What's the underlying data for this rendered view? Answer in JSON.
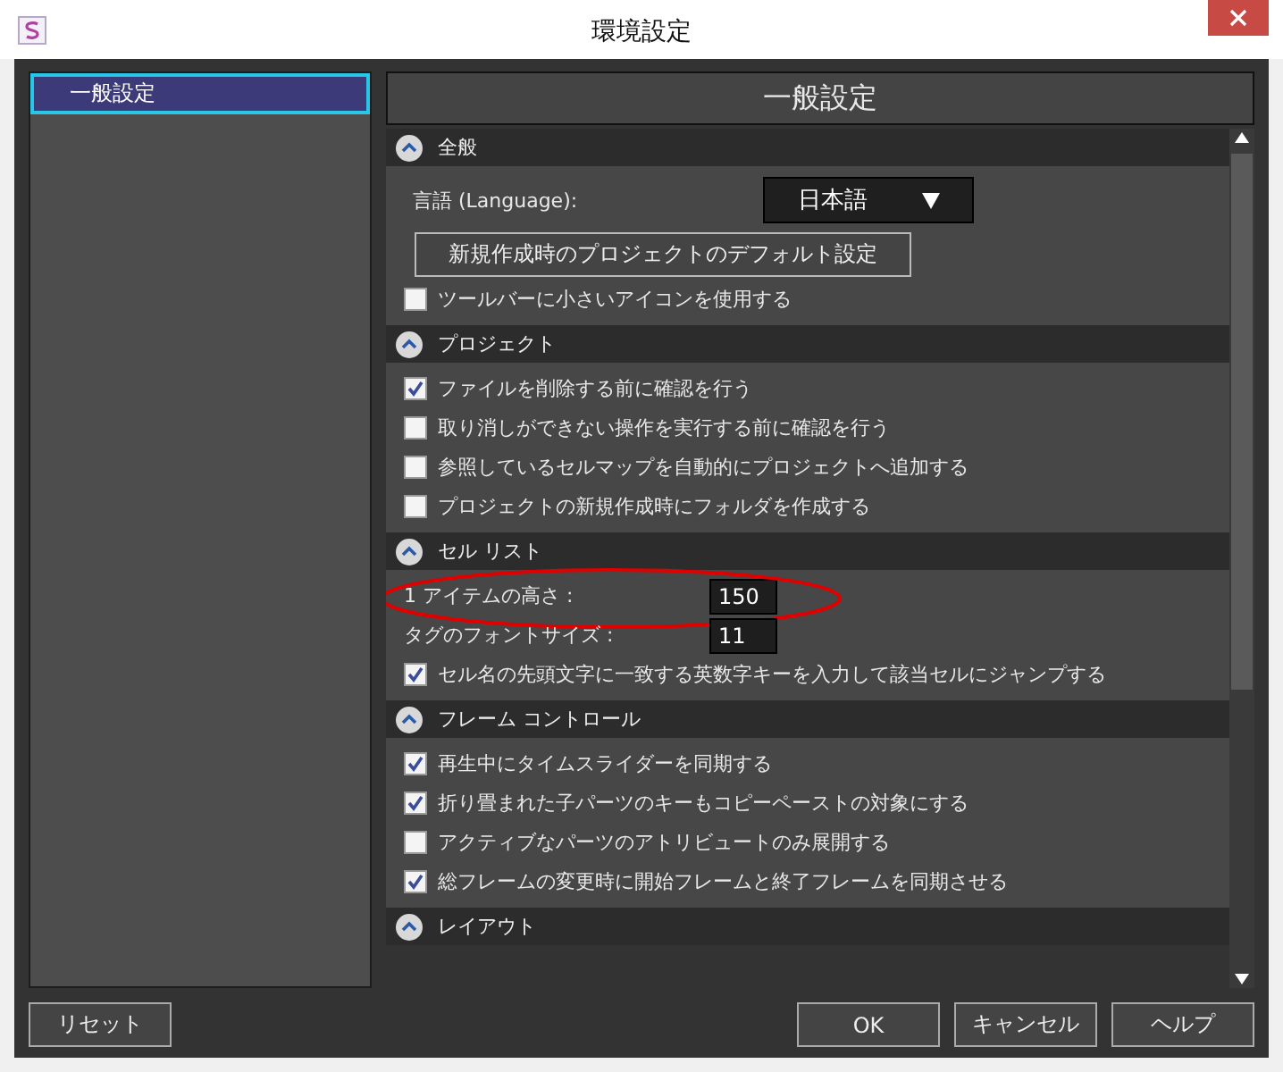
{
  "window": {
    "title": "環境設定"
  },
  "sidebar": {
    "items": [
      {
        "label": "一般設定",
        "selected": true
      }
    ]
  },
  "panel": {
    "title": "一般設定"
  },
  "sections": [
    {
      "title": "全般",
      "expanded": true,
      "items": [
        {
          "kind": "select",
          "label": "言語 (Language):",
          "value": "日本語"
        },
        {
          "kind": "button",
          "label": "新規作成時のプロジェクトのデフォルト設定"
        },
        {
          "kind": "checkbox",
          "label": "ツールバーに小さいアイコンを使用する",
          "checked": false
        }
      ]
    },
    {
      "title": "プロジェクト",
      "expanded": true,
      "items": [
        {
          "kind": "checkbox",
          "label": "ファイルを削除する前に確認を行う",
          "checked": true
        },
        {
          "kind": "checkbox",
          "label": "取り消しができない操作を実行する前に確認を行う",
          "checked": false
        },
        {
          "kind": "checkbox",
          "label": "参照しているセルマップを自動的にプロジェクトへ追加する",
          "checked": false
        },
        {
          "kind": "checkbox",
          "label": "プロジェクトの新規作成時にフォルダを作成する",
          "checked": false
        }
      ]
    },
    {
      "title": "セル リスト",
      "expanded": true,
      "items": [
        {
          "kind": "number",
          "label": "1 アイテムの高さ :",
          "value": "150",
          "highlighted": true
        },
        {
          "kind": "number",
          "label": "タグのフォントサイズ :",
          "value": "11",
          "highlighted": false
        },
        {
          "kind": "checkbox",
          "label": "セル名の先頭文字に一致する英数字キーを入力して該当セルにジャンプする",
          "checked": true
        }
      ]
    },
    {
      "title": "フレーム コントロール",
      "expanded": true,
      "items": [
        {
          "kind": "checkbox",
          "label": "再生中にタイムスライダーを同期する",
          "checked": true
        },
        {
          "kind": "checkbox",
          "label": "折り畳まれた子パーツのキーもコピーペーストの対象にする",
          "checked": true
        },
        {
          "kind": "checkbox",
          "label": "アクティブなパーツのアトリビュートのみ展開する",
          "checked": false
        },
        {
          "kind": "checkbox",
          "label": "総フレームの変更時に開始フレームと終了フレームを同期させる",
          "checked": true
        }
      ]
    },
    {
      "title": "レイアウト",
      "expanded": true
    }
  ],
  "reset_button": "リセット",
  "buttons": [
    "OK",
    "キャンセル",
    "ヘルプ"
  ]
}
